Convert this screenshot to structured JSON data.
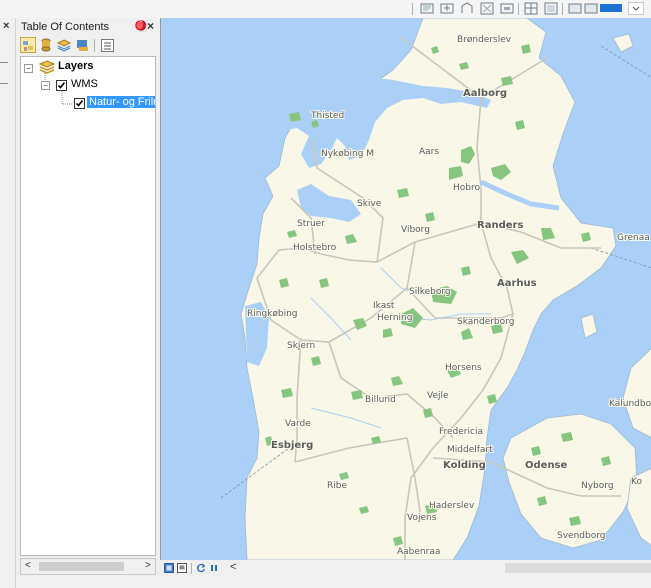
{
  "toolbar": {
    "icons": [
      "pan-icon",
      "zoom-in-icon",
      "zoom-out-icon",
      "full-extent-icon",
      "select-features-icon",
      "identify-icon",
      "layout-icon",
      "measure-icon",
      "back-extent-icon",
      "forward-extent-icon",
      "color-swatch-icon",
      "dropdown-icon"
    ]
  },
  "left_panel": {
    "close_glyph": "×"
  },
  "toc": {
    "title": "Table Of Contents",
    "pin_glyph": "ᵖ",
    "close_glyph": "×",
    "tools": [
      "list-by-drawing-order-icon",
      "list-by-source-icon",
      "list-by-visibility-icon",
      "list-by-selection-icon",
      "options-icon"
    ],
    "tree": {
      "root_label": "Layers",
      "group_label": "WMS",
      "layer_label": "Natur- og Friluf"
    },
    "scroll": {
      "left": "<",
      "right": ">"
    }
  },
  "map": {
    "colors": {
      "water": "#abd0f7",
      "land": "#f8f7e8",
      "forest": "#86c67f",
      "road": "#c9c6bd"
    },
    "cities": [
      "Brønderslev",
      "Aalborg",
      "Thisted",
      "Nykøbing M",
      "Aars",
      "Hobro",
      "Skive",
      "Struer",
      "Viborg",
      "Randers",
      "Grenaa",
      "Holstebro",
      "Silkeborg",
      "Aarhus",
      "Ikast",
      "Ringkøbing",
      "Herning",
      "Skanderborg",
      "Skjern",
      "Horsens",
      "Billund",
      "Vejle",
      "Varde",
      "Kalundborg",
      "Fredericia",
      "Esbjerg",
      "Middelfart",
      "Kolding",
      "Odense",
      "Nyborg",
      "Ribe",
      "Haderslev",
      "Vojens",
      "Svendborg",
      "Aabenraa",
      "Ko"
    ]
  },
  "bottom_bar": {
    "left_arrow": "<"
  }
}
